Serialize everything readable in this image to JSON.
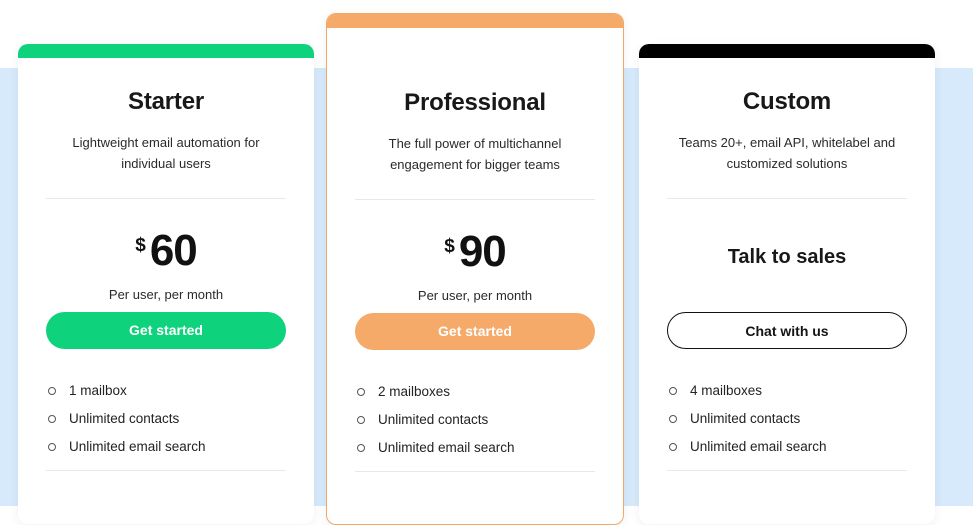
{
  "theme": {
    "band_color": "#d7eafb",
    "page_background": "#ffffff",
    "green": "#0ed37c",
    "orange": "#f5aa6a",
    "black": "#111111"
  },
  "plans": [
    {
      "id": "starter",
      "accent_color": "#0ed37c",
      "name": "Starter",
      "description": "Lightweight email automation for individual users",
      "currency": "$",
      "amount": "60",
      "price_note": "Per user, per month",
      "cta_label": "Get started",
      "features": [
        "1 mailbox",
        "Unlimited contacts",
        "Unlimited email search"
      ]
    },
    {
      "id": "professional",
      "accent_color": "#f5aa6a",
      "name": "Professional",
      "description": "The full power of multichannel engagement for bigger teams",
      "currency": "$",
      "amount": "90",
      "price_note": "Per user, per month",
      "cta_label": "Get started",
      "features": [
        "2 mailboxes",
        "Unlimited contacts",
        "Unlimited email search"
      ]
    },
    {
      "id": "custom",
      "accent_color": "#000000",
      "name": "Custom",
      "description": "Teams 20+, email API, whitelabel and customized solutions",
      "talk_to_sales": "Talk to sales",
      "cta_label": "Chat with us",
      "features": [
        "4 mailboxes",
        "Unlimited contacts",
        "Unlimited email search"
      ]
    }
  ]
}
